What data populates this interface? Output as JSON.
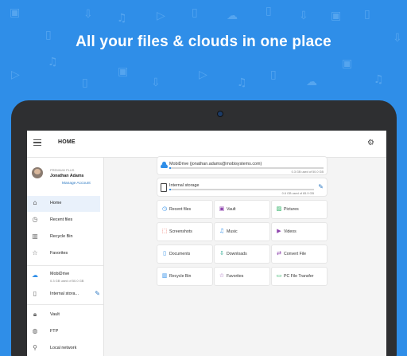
{
  "headline": "All your files & clouds in one place",
  "topbar": {
    "title": "HOME",
    "menu_icon": "hamburger-icon",
    "settings_icon": "tune-icon"
  },
  "account": {
    "plan": "PREMIUM PLUS",
    "name": "Jonathan Adams",
    "manage_label": "Manage Account"
  },
  "sidebar": {
    "items": [
      {
        "label": "Home",
        "icon": "home-icon"
      },
      {
        "label": "Recent files",
        "icon": "clock-icon"
      },
      {
        "label": "Recycle Bin",
        "icon": "trash-icon"
      },
      {
        "label": "Favorites",
        "icon": "star-icon"
      }
    ],
    "storage": [
      {
        "label": "MobiDrive",
        "sub": "0.3 GB used of 50.0 GB",
        "icon": "cloud-icon"
      },
      {
        "label": "Internal stora...",
        "icon": "phone-icon"
      }
    ],
    "more": [
      {
        "label": "Vault",
        "icon": "lock-icon"
      },
      {
        "label": "FTP",
        "icon": "globe-icon"
      },
      {
        "label": "Local network",
        "icon": "network-icon"
      }
    ]
  },
  "storage_cards": [
    {
      "name": "MobiDrive (jonathan.adams@mobisystems.com)",
      "used": "0.3 GB used of 50.0 GB",
      "fill": 0.01,
      "icon": "cloud-icon"
    },
    {
      "name": "Internal storage",
      "used": "0.6 GB used of 65.9 GB",
      "fill": 0.01,
      "icon": "phone-icon"
    }
  ],
  "tiles": [
    {
      "label": "Recent files",
      "icon": "clock-icon",
      "color": "#2f8ee8"
    },
    {
      "label": "Vault",
      "icon": "lock-icon",
      "color": "#8e44ad"
    },
    {
      "label": "Pictures",
      "icon": "image-icon",
      "color": "#27ae60"
    },
    {
      "label": "Screenshots",
      "icon": "screenshot-icon",
      "color": "#e74c3c"
    },
    {
      "label": "Music",
      "icon": "music-icon",
      "color": "#2f8ee8"
    },
    {
      "label": "Videos",
      "icon": "video-icon",
      "color": "#8e44ad"
    },
    {
      "label": "Documents",
      "icon": "document-icon",
      "color": "#2f8ee8"
    },
    {
      "label": "Downloads",
      "icon": "download-icon",
      "color": "#16a085"
    },
    {
      "label": "Convert File",
      "icon": "convert-icon",
      "color": "#8e44ad"
    },
    {
      "label": "Recycle Bin",
      "icon": "trash-icon",
      "color": "#2f8ee8"
    },
    {
      "label": "Favorites",
      "icon": "star-icon",
      "color": "#8e44ad"
    },
    {
      "label": "PC File Transfer",
      "icon": "pc-transfer-icon",
      "color": "#27ae60"
    }
  ],
  "colors": {
    "background": "#2f8ee8",
    "accent": "#2b78c2",
    "tablet_frame": "#2e2f31"
  }
}
